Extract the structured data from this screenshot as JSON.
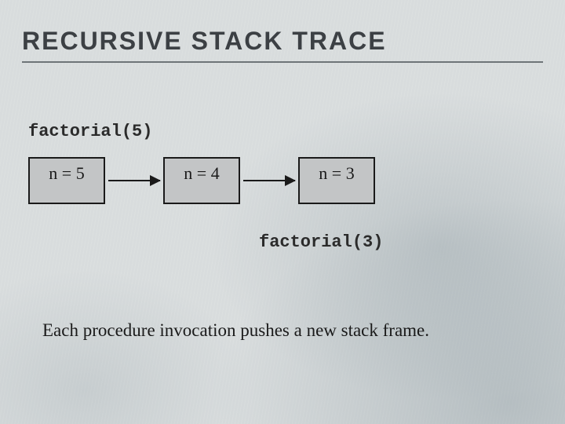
{
  "title": "RECURSIVE STACK TRACE",
  "call_top": "factorial(5)",
  "frames": [
    {
      "label": "n = 5"
    },
    {
      "label": "n = 4"
    },
    {
      "label": "n = 3"
    }
  ],
  "call_current": "factorial(3)",
  "caption": "Each procedure invocation pushes a new stack frame.",
  "colors": {
    "frame_fill": "#c3c5c6",
    "frame_border": "#1a1a1a",
    "title_color": "#3c4044",
    "underline": "#6e7578"
  }
}
